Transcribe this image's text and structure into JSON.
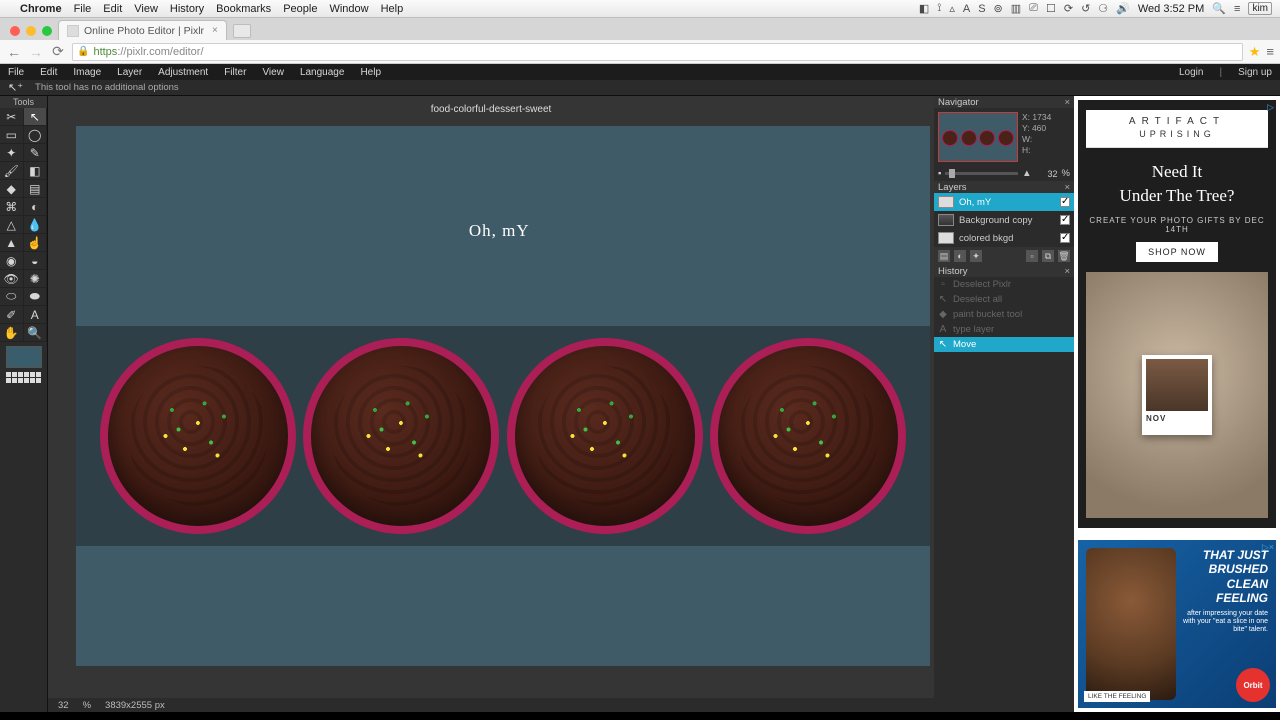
{
  "mac": {
    "app": "Chrome",
    "menus": [
      "File",
      "Edit",
      "View",
      "History",
      "Bookmarks",
      "People",
      "Window",
      "Help"
    ],
    "clock": "Wed 3:52 PM",
    "user": "kim"
  },
  "chrome": {
    "tab_title": "Online Photo Editor | Pixlr",
    "url_secure": "https",
    "url_host": "://pixlr.com",
    "url_path": "/editor/"
  },
  "pixlr": {
    "menus": [
      "File",
      "Edit",
      "Image",
      "Layer",
      "Adjustment",
      "Filter",
      "View",
      "Language",
      "Help"
    ],
    "login": "Login",
    "signup": "Sign up",
    "options_msg": "This tool has no additional options",
    "tools_title": "Tools",
    "doc_title": "food-colorful-dessert-sweet",
    "canvas_text": "Oh, mY",
    "status_zoom": "32",
    "status_pct": "%",
    "status_dims": "3839x2555 px",
    "navigator": {
      "title": "Navigator",
      "x_label": "X:",
      "x": "1734",
      "y_label": "Y:",
      "y": "460",
      "w_label": "W:",
      "w": "",
      "h_label": "H:",
      "h": "",
      "zoom": "32",
      "pct": "%"
    },
    "layers": {
      "title": "Layers",
      "items": [
        {
          "name": "Oh, mY",
          "selected": true,
          "visible": true,
          "thumb": "plain"
        },
        {
          "name": "Background copy",
          "selected": false,
          "visible": true,
          "thumb": "img"
        },
        {
          "name": "colored bkgd",
          "selected": false,
          "visible": true,
          "thumb": "plain"
        }
      ]
    },
    "history": {
      "title": "History",
      "items": [
        {
          "label": "Deselect Pixlr",
          "icon": "▫",
          "sel": false
        },
        {
          "label": "Deselect all",
          "icon": "↖",
          "sel": false
        },
        {
          "label": "paint bucket tool",
          "icon": "◆",
          "sel": false
        },
        {
          "label": "type layer",
          "icon": "A",
          "sel": false
        },
        {
          "label": "Move",
          "icon": "↖",
          "sel": true
        }
      ]
    }
  },
  "ads": {
    "a1": {
      "brand1": "ARTIFACT",
      "brand2": "UPRISING",
      "h1a": "Need It",
      "h1b": "Under The Tree?",
      "sub": "CREATE YOUR PHOTO GIFTS BY DEC 14TH",
      "cta": "SHOP NOW",
      "cal": "NOV"
    },
    "a2": {
      "line1": "THAT JUST",
      "line2": "BRUSHED",
      "line3": "CLEAN",
      "line4": "FEELING",
      "sm": "after impressing your date with your \"eat a slice in one bite\" talent.",
      "brand": "Orbit",
      "like": "LIKE THE FEELING"
    }
  }
}
